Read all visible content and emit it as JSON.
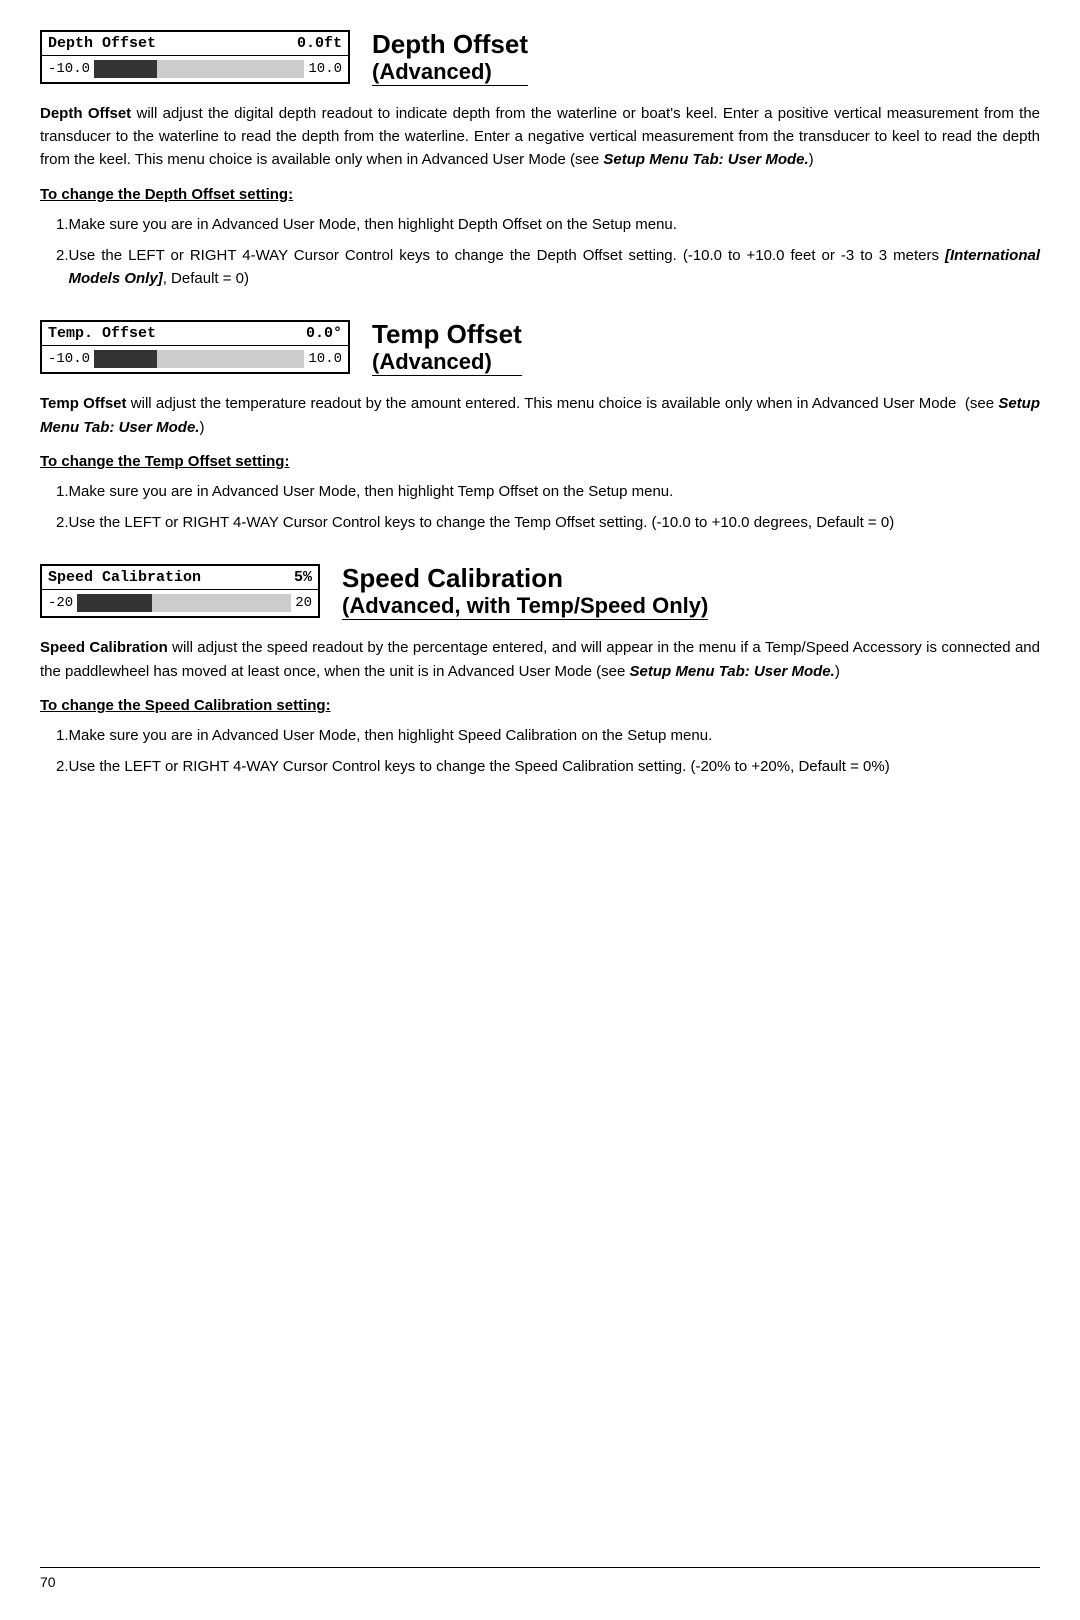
{
  "depth_offset": {
    "widget": {
      "label": "Depth Offset",
      "value": "0.0ft",
      "slider_min": "-10.0",
      "slider_max": "10.0"
    },
    "title": "Depth Offset",
    "subtitle": "(Advanced)",
    "body": [
      "<b>Depth Offset</b> will adjust the digital depth readout to indicate depth from the waterline or boat's keel. Enter a positive vertical measurement from the transducer to the waterline to read the depth from the waterline. Enter a negative vertical measurement from the transducer to keel to read the depth from the keel. This menu choice is available only when in Advanced User Mode (see <b><i>Setup Menu Tab: User Mode.</i></b>)"
    ],
    "instruction_heading": "To change the Depth Offset setting:",
    "instructions": [
      "Make sure you are in Advanced User Mode, then highlight Depth Offset on the Setup menu.",
      "Use the LEFT or RIGHT 4-WAY Cursor Control keys to change the Depth Offset setting. (-10.0 to +10.0 feet or -3 to 3 meters <b><i>[International Models Only]</i></b>, Default = 0)"
    ]
  },
  "temp_offset": {
    "widget": {
      "label": "Temp. Offset",
      "value": "0.0°",
      "slider_min": "-10.0",
      "slider_max": "10.0"
    },
    "title": "Temp Offset",
    "subtitle": "(Advanced)",
    "body": [
      "<b>Temp Offset</b> will adjust the temperature readout by the amount entered. This menu choice is available only when in Advanced User Mode  (see <b><i>Setup Menu Tab: User Mode.</i></b>)"
    ],
    "instruction_heading": "To change the Temp Offset setting:",
    "instructions": [
      "Make sure you are in Advanced User Mode, then highlight Temp Offset on the Setup menu.",
      "Use the LEFT or RIGHT 4-WAY Cursor Control keys to change the Temp Offset setting. (-10.0 to +10.0 degrees, Default = 0)"
    ]
  },
  "speed_calibration": {
    "widget": {
      "label": "Speed Calibration",
      "value": "5%",
      "slider_min": "-20",
      "slider_max": "20"
    },
    "title": "Speed Calibration",
    "subtitle": "(Advanced, with Temp/Speed Only)",
    "body": [
      "<b>Speed Calibration</b> will adjust the speed readout by the percentage entered, and will appear in the menu if a Temp/Speed Accessory is connected and the paddlewheel has moved at least once, when the unit is in Advanced User Mode (see <b><i>Setup Menu Tab: User Mode.</i></b>)"
    ],
    "instruction_heading": "To change the Speed Calibration setting:",
    "instructions": [
      "Make sure you are in Advanced User Mode, then highlight Speed Calibration on the Setup menu.",
      "Use the LEFT or RIGHT 4-WAY Cursor Control keys to change the Speed Calibration setting. (-20% to +20%, Default = 0%)"
    ]
  },
  "footer": {
    "page_number": "70"
  }
}
